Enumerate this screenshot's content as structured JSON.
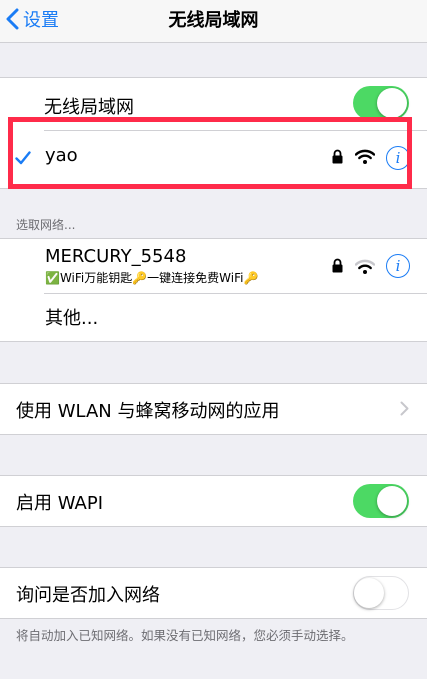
{
  "nav": {
    "back_label": "设置",
    "title": "无线局域网"
  },
  "wlan": {
    "label": "无线局域网",
    "toggle_on": true,
    "connected_network": "yao"
  },
  "networks": {
    "section_header": "选取网络...",
    "items": [
      {
        "name": "MERCURY_5548",
        "subtitle": "✅WiFi万能钥匙🔑一键连接免费WiFi🔑"
      }
    ],
    "other_label": "其他..."
  },
  "wlan_apps": {
    "label": "使用 WLAN 与蜂窝移动网的应用"
  },
  "wapi": {
    "label": "启用 WAPI",
    "toggle_on": true
  },
  "ask_join": {
    "label": "询问是否加入网络",
    "toggle_on": false,
    "footer": "将自动加入已知网络。如果没有已知网络，您必须手动选择。"
  },
  "colors": {
    "accent": "#1a7cf5",
    "toggle_on": "#4cd964",
    "highlight": "#ff2b4a",
    "background": "#efeff4"
  }
}
